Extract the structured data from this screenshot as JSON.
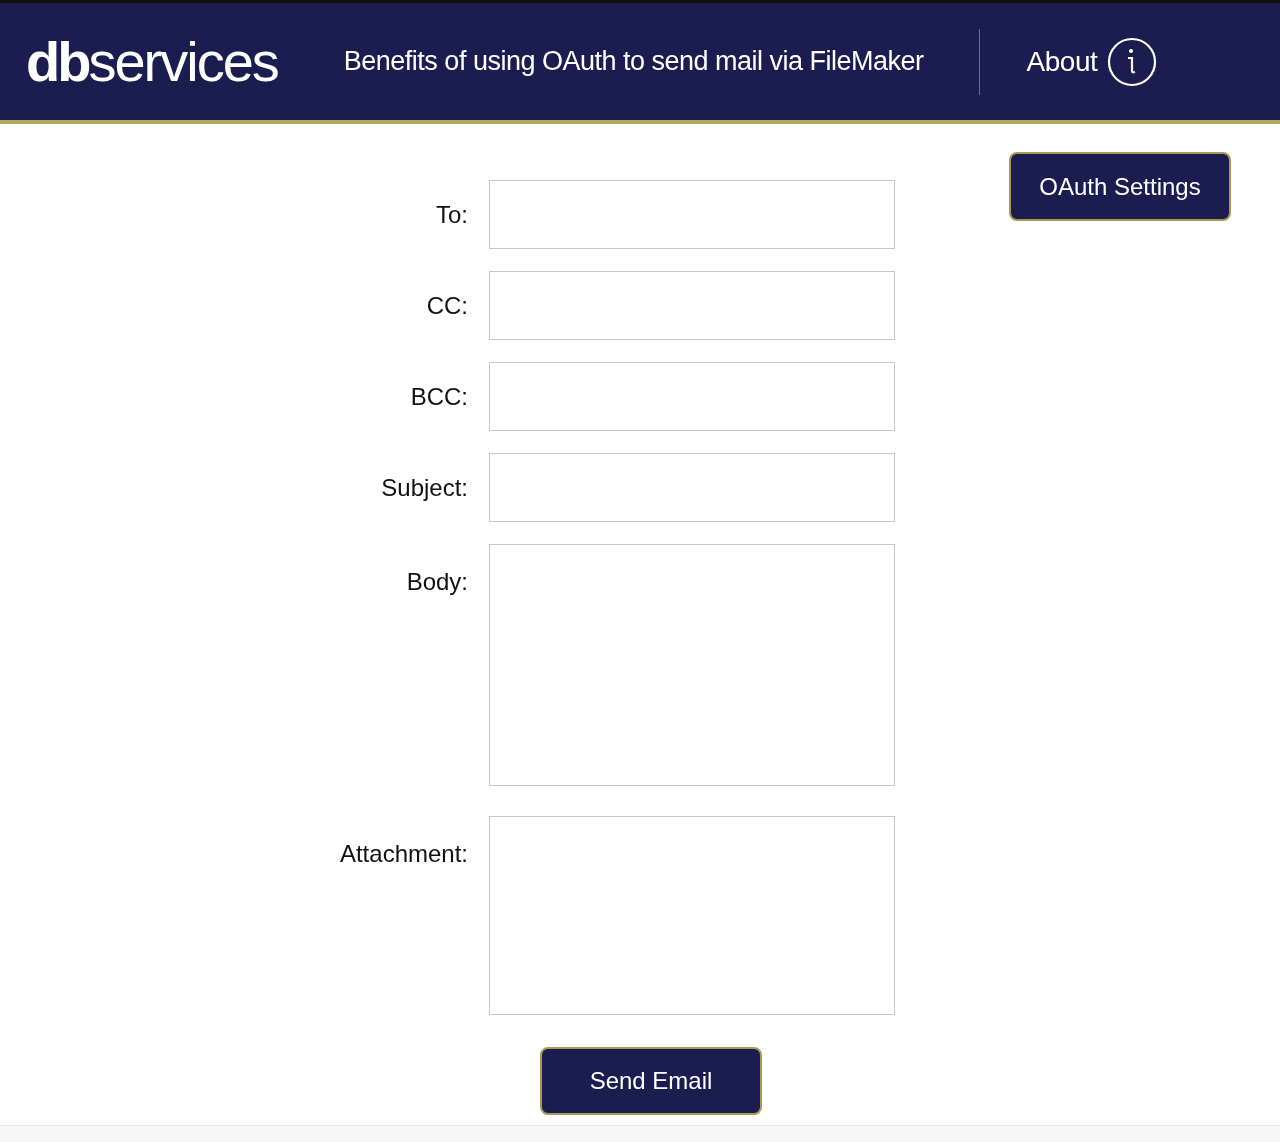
{
  "header": {
    "logo": "**db**services",
    "title": "Benefits of using OAuth to send mail via FileMaker",
    "about": "About"
  },
  "settings_button": "OAuth Settings",
  "fields": [
    {
      "label": "To:",
      "kind": "line"
    },
    {
      "label": "CC:",
      "kind": "line"
    },
    {
      "label": "BCC:",
      "kind": "line"
    },
    {
      "label": "Subject:",
      "kind": "line"
    },
    {
      "label": "Body:",
      "kind": "area"
    },
    {
      "label": "Attachment:",
      "kind": "attachment"
    }
  ],
  "send_button": "Send Email"
}
